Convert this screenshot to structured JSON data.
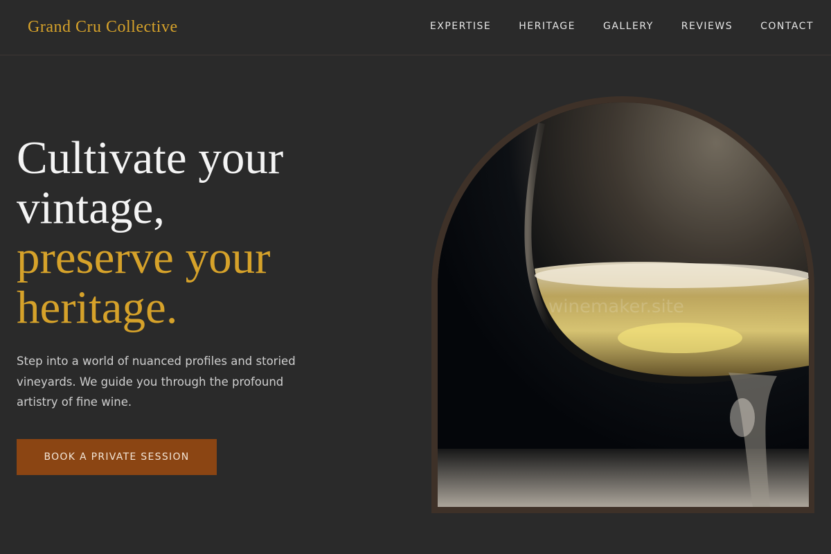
{
  "header": {
    "brand": "Grand Cru Collective",
    "nav": [
      "EXPERTISE",
      "HERITAGE",
      "GALLERY",
      "REVIEWS",
      "CONTACT"
    ]
  },
  "hero": {
    "title_lines_white": [
      "Cultivate your",
      "vintage,"
    ],
    "title_lines_gold": [
      "preserve your",
      "heritage."
    ],
    "subtitle": "Step into a world of nuanced profiles and storied vineyards. We guide you through the profound artistry of fine wine.",
    "cta_label": "BOOK A PRIVATE SESSION"
  },
  "image": {
    "subject": "wine-glass-photo",
    "watermark": "winemaker.site"
  },
  "colors": {
    "background": "#2a2a2a",
    "accent_gold": "#d6a22a",
    "cta_brown": "#8b4513",
    "frame_brown": "#3e3128"
  }
}
